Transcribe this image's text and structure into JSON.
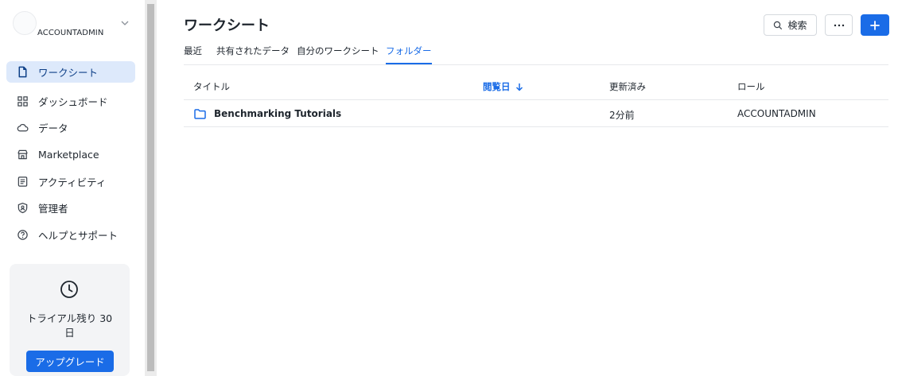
{
  "account": {
    "name": "ACCOUNTADMIN",
    "chevron_icon": "chevron-down-icon"
  },
  "sidebar": {
    "items": [
      {
        "label": "ワークシート",
        "icon": "worksheet-icon",
        "active": true
      },
      {
        "label": "ダッシュボード",
        "icon": "dashboard-grid-icon",
        "active": false
      },
      {
        "label": "データ",
        "icon": "cloud-icon",
        "active": false
      },
      {
        "label": "Marketplace",
        "icon": "storefront-icon",
        "active": false
      },
      {
        "label": "アクティビティ",
        "icon": "activity-list-icon",
        "active": false
      },
      {
        "label": "管理者",
        "icon": "admin-shield-icon",
        "active": false
      },
      {
        "label": "ヘルプとサポート",
        "icon": "help-circle-icon",
        "active": false
      }
    ],
    "trial": {
      "text_line1": "トライアル残り 30",
      "text_line2": "日",
      "upgrade_label": "アップグレード"
    }
  },
  "header": {
    "title": "ワークシート",
    "search_label": "検索",
    "more_label": "···",
    "add_label": "+"
  },
  "tabs": [
    {
      "label": "最近",
      "active": false
    },
    {
      "label": "共有されたデータ",
      "active": false
    },
    {
      "label": "自分のワークシート",
      "active": false
    },
    {
      "label": "フォルダー",
      "active": true
    }
  ],
  "table": {
    "columns": {
      "title": "タイトル",
      "viewed": "閲覧日",
      "updated": "更新済み",
      "role": "ロール"
    },
    "rows": [
      {
        "title": "Benchmarking Tutorials",
        "viewed": "",
        "updated": "2分前",
        "role": "ACCOUNTADMIN"
      }
    ]
  },
  "colors": {
    "accent": "#1a6ce7",
    "active_bg": "#dde9fb"
  }
}
